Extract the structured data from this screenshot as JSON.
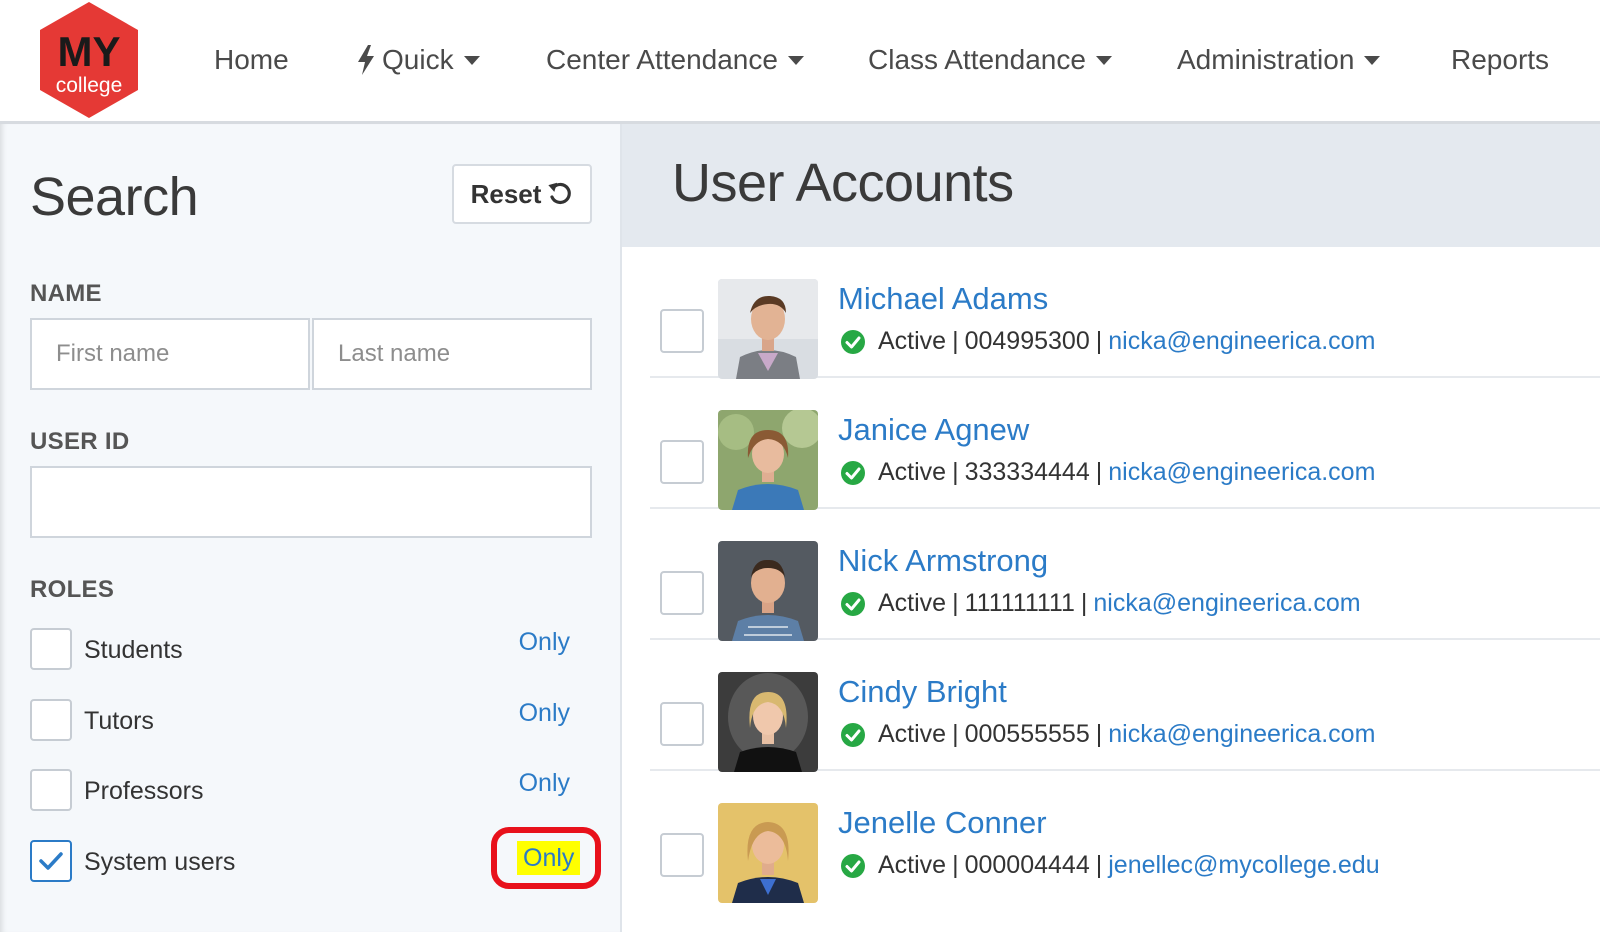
{
  "logo": {
    "top_text": "MY",
    "bottom_text": "college",
    "color": "#e53935"
  },
  "nav": {
    "home": "Home",
    "quick": "Quick",
    "center_attendance": "Center Attendance",
    "class_attendance": "Class Attendance",
    "administration": "Administration",
    "reports": "Reports"
  },
  "search": {
    "title": "Search",
    "reset_label": "Reset",
    "name_label": "NAME",
    "first_name_placeholder": "First name",
    "last_name_placeholder": "Last name",
    "user_id_label": "USER ID",
    "user_id_value": "",
    "roles_label": "ROLES",
    "roles": [
      {
        "label": "Students",
        "only": "Only",
        "checked": false
      },
      {
        "label": "Tutors",
        "only": "Only",
        "checked": false
      },
      {
        "label": "Professors",
        "only": "Only",
        "checked": false
      },
      {
        "label": "System users",
        "only": "Only",
        "checked": true
      }
    ]
  },
  "content": {
    "title": "User Accounts",
    "users": [
      {
        "name": "Michael Adams",
        "status": "Active",
        "id": "004995300",
        "email": "nicka@engineerica.com"
      },
      {
        "name": "Janice Agnew",
        "status": "Active",
        "id": "333334444",
        "email": "nicka@engineerica.com"
      },
      {
        "name": "Nick Armstrong",
        "status": "Active",
        "id": "111111111",
        "email": "nicka@engineerica.com"
      },
      {
        "name": "Cindy Bright",
        "status": "Active",
        "id": "000555555",
        "email": "nicka@engineerica.com"
      },
      {
        "name": "Jenelle Conner",
        "status": "Active",
        "id": "000004444",
        "email": "jenellec@mycollege.edu"
      }
    ]
  },
  "colors": {
    "link": "#2b7bc7",
    "active_green": "#27a844",
    "highlight_red": "#e8111b",
    "highlight_yellow": "#ffff00"
  }
}
